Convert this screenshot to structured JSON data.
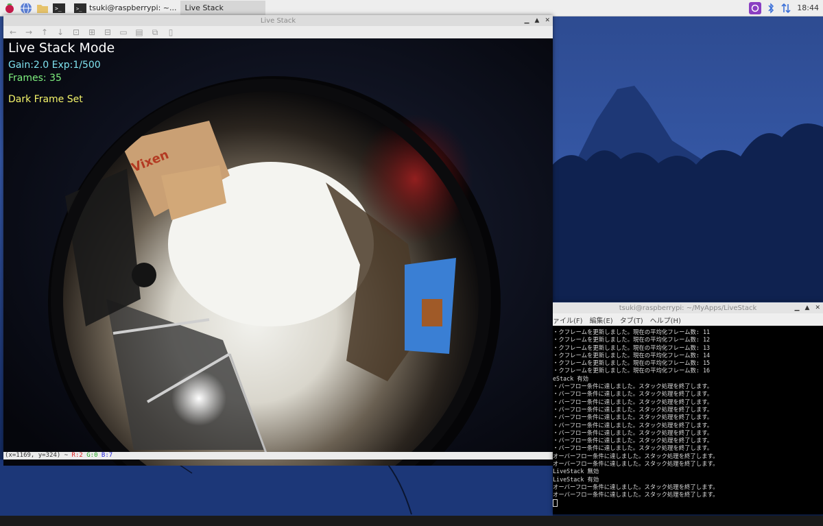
{
  "taskbar": {
    "tasks": [
      {
        "label": "tsuki@raspberrypi: ~..."
      },
      {
        "label": "Live Stack"
      }
    ],
    "clock": "18:44"
  },
  "livestack": {
    "title": "Live Stack",
    "overlay": {
      "mode": "Live Stack Mode",
      "gain_exp": "Gain:2.0 Exp:1/500",
      "frames": "Frames: 35",
      "dark": "Dark Frame Set"
    },
    "status": {
      "coords": "(x=1169, y=324) ~ ",
      "r": "R:2",
      "g": "G:0",
      "b": "B:7"
    }
  },
  "terminal": {
    "title": "tsuki@raspberrypi: ~/MyApps/LiveStack",
    "menu": [
      "ァイル(F)",
      "編集(E)",
      "タブ(T)",
      "ヘルプ(H)"
    ],
    "lines": [
      "・クフレームを更新しました。現在の平均化フレーム数: 11",
      "・クフレームを更新しました。現在の平均化フレーム数: 12",
      "・クフレームを更新しました。現在の平均化フレーム数: 13",
      "・クフレームを更新しました。現在の平均化フレーム数: 14",
      "・クフレームを更新しました。現在の平均化フレーム数: 15",
      "・クフレームを更新しました。現在の平均化フレーム数: 16",
      "eStack 有効",
      "・バーフロー条件に達しました。スタック処理を終了します。",
      "・バーフロー条件に達しました。スタック処理を終了します。",
      "・バーフロー条件に達しました。スタック処理を終了します。",
      "・バーフロー条件に達しました。スタック処理を終了します。",
      "・バーフロー条件に達しました。スタック処理を終了します。",
      "・バーフロー条件に達しました。スタック処理を終了します。",
      "・バーフロー条件に達しました。スタック処理を終了します。",
      "・バーフロー条件に達しました。スタック処理を終了します。",
      "・バーフロー条件に達しました。スタック処理を終了します。",
      "オーバーフロー条件に達しました。スタック処理を終了します。",
      "オーバーフロー条件に達しました。スタック処理を終了します。",
      "LiveStack 無効",
      "LiveStack 有効",
      "オーバーフロー条件に達しました。スタック処理を終了します。",
      "オーバーフロー条件に達しました。スタック処理を終了します。"
    ]
  },
  "colors": {
    "overlay_white": "#ffffff",
    "overlay_cyan": "#7fe3f0",
    "overlay_green": "#7ff07f",
    "overlay_yellow": "#f5f56a"
  }
}
